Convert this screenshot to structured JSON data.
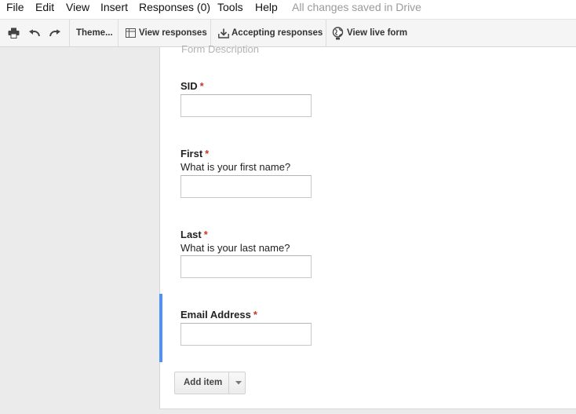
{
  "menu": {
    "items": [
      "File",
      "Edit",
      "View",
      "Insert",
      "Responses (0)",
      "Tools",
      "Help"
    ],
    "status": "All changes saved in Drive"
  },
  "toolbar": {
    "theme_label": "Theme...",
    "view_responses_label": "View responses",
    "accepting_label": "Accepting responses",
    "view_live_label": "View live form"
  },
  "form": {
    "description_placeholder": "Form Description",
    "questions": [
      {
        "title": "SID",
        "required_mark": "*",
        "help": ""
      },
      {
        "title": "First",
        "required_mark": "*",
        "help": "What is your first name?"
      },
      {
        "title": "Last",
        "required_mark": "*",
        "help": "What is your last name?"
      },
      {
        "title": "Email Address",
        "required_mark": "*",
        "help": ""
      }
    ],
    "add_item_label": "Add item"
  },
  "colors": {
    "required": "#c53929",
    "selection": "#4d90fe"
  },
  "icons": [
    "print-icon",
    "undo-icon",
    "redo-icon",
    "table-icon",
    "download-icon",
    "globe-icon",
    "dropdown-arrow-icon"
  ]
}
